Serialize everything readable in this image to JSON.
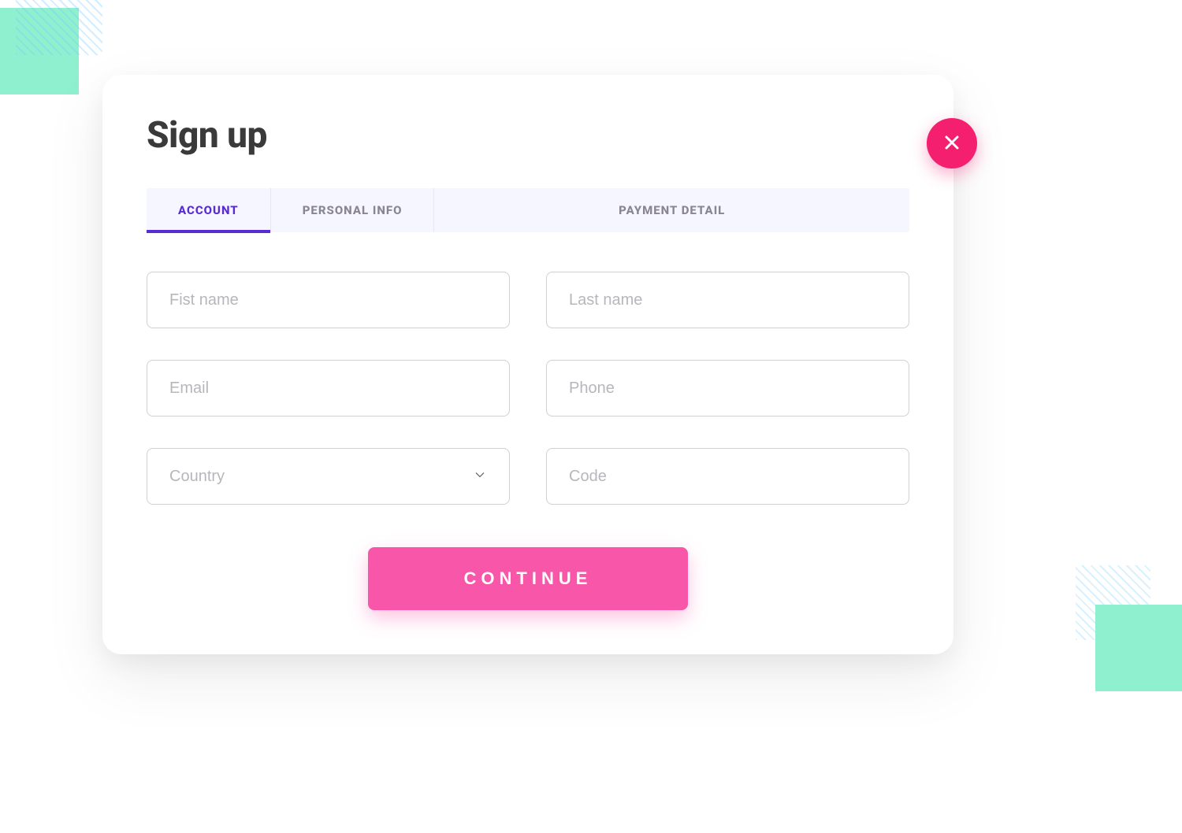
{
  "title": "Sign up",
  "tabs": [
    {
      "label": "ACCOUNT",
      "active": true
    },
    {
      "label": "PERSONAL INFO",
      "active": false
    },
    {
      "label": "PAYMENT DETAIL",
      "active": false
    }
  ],
  "fields": {
    "first_name": {
      "placeholder": "Fist name",
      "value": ""
    },
    "last_name": {
      "placeholder": "Last name",
      "value": ""
    },
    "email": {
      "placeholder": "Email",
      "value": ""
    },
    "phone": {
      "placeholder": "Phone",
      "value": ""
    },
    "country": {
      "placeholder": "Country",
      "value": ""
    },
    "code": {
      "placeholder": "Code",
      "value": ""
    }
  },
  "buttons": {
    "continue": "CONTINUE"
  },
  "colors": {
    "accent_purple": "#5a2bd1",
    "accent_pink": "#f856a8",
    "close_pink": "#f41f6f",
    "mint": "#8ff0cf"
  }
}
